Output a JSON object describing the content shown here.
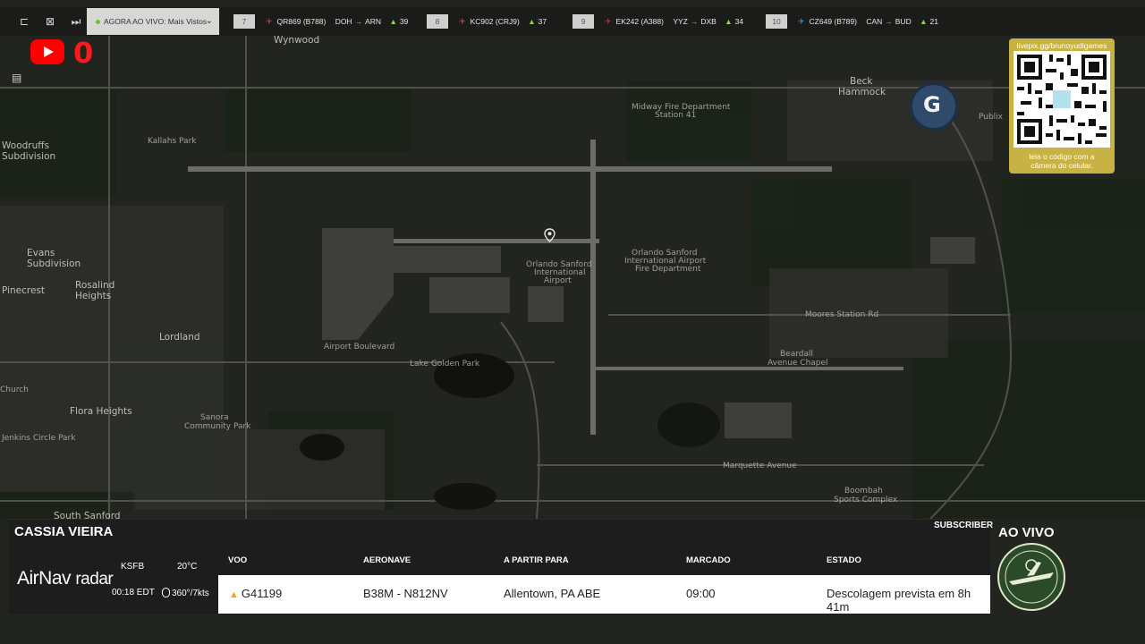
{
  "header": {
    "now_live_label": "AGORA AO VIVO: Mais Vistos",
    "flights": [
      {
        "num": "7",
        "callsign": "QR869 (B788)",
        "from": "DOH",
        "to": "ARN",
        "count": "39"
      },
      {
        "num": "8",
        "callsign": "KC902 (CRJ9)",
        "from": "",
        "to": "",
        "count": "37"
      },
      {
        "num": "9",
        "callsign": "EK242 (A388)",
        "from": "YYZ",
        "to": "DXB",
        "count": "34"
      },
      {
        "num": "10",
        "callsign": "CZ649 (B789)",
        "from": "CAN",
        "to": "BUD",
        "count": "21"
      }
    ]
  },
  "youtube": {
    "count": "0"
  },
  "badge": {
    "letter": "G"
  },
  "qr": {
    "url": "livepix.gg/brunoyudigames",
    "caption_line1": "leia o código com a",
    "caption_line2": "câmera do celular."
  },
  "map": {
    "labels": [
      "Wynwood",
      "Woodruffs Subdivision",
      "Kallahs Park",
      "Evans Subdivision",
      "Pinecrest",
      "Rosalind Heights",
      "Lordland",
      "Flora Heights",
      "Sanora Community Park",
      "Jenkins Circle Park",
      "South Sanford",
      "Orlando Sanford International Airport",
      "Orlando Sanford International Fire Department",
      "Midway Fire Department Station 41",
      "Beck Hammock",
      "Lake Golden Park",
      "Moores Station Rd",
      "Beardall Avenue Chapel",
      "Marquette Avenue",
      "Boombah Sports Complex",
      "Publix",
      "Airport Boulevard",
      "Church"
    ]
  },
  "panel": {
    "name": "CASSIA VIEIRA",
    "subscriber": "SUBSCRIBER",
    "brand_main": "AirNav",
    "brand_sub": "radar",
    "airport": "KSFB",
    "time": "00:18 EDT",
    "temperature": "20°C",
    "wind": "360°/7kts",
    "headers": {
      "flight": "VOO",
      "aircraft": "AERONAVE",
      "route": "A PARTIR PARA",
      "scheduled": "MARCADO",
      "status": "ESTADO"
    },
    "row": {
      "flight": "G41199",
      "aircraft": "B38M - N812NV",
      "route": "Allentown, PA ABE",
      "scheduled": "09:00",
      "status": "Descolagem prevista em 8h 41m"
    }
  },
  "live_label": "AO VIVO",
  "colors": {
    "youtube_red": "#ff0000",
    "qr_panel": "#c9b244",
    "signal_green": "#8fd15a"
  }
}
